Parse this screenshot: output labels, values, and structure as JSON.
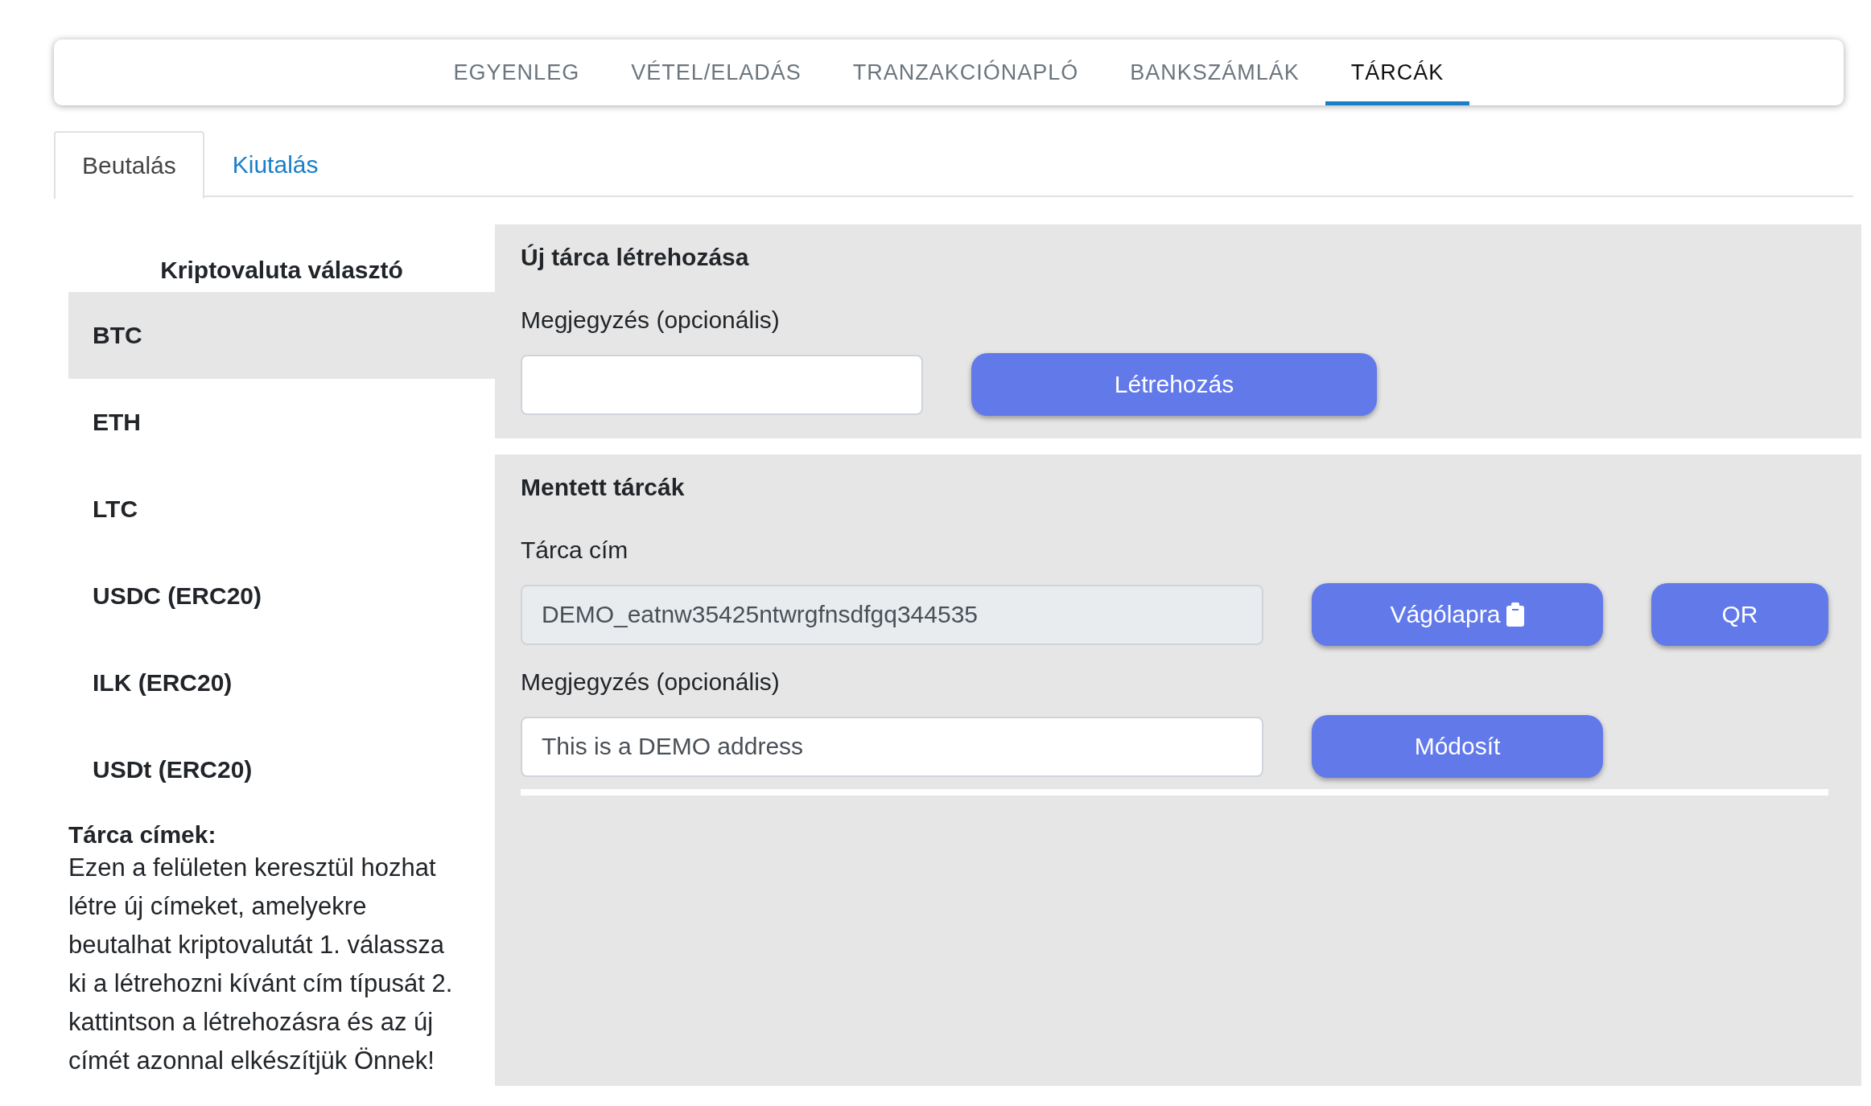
{
  "nav": {
    "items": [
      {
        "label": "EGYENLEG",
        "selected": false
      },
      {
        "label": "VÉTEL/ELADÁS",
        "selected": false
      },
      {
        "label": "TRANZAKCIÓNAPLÓ",
        "selected": false
      },
      {
        "label": "BANKSZÁMLÁK",
        "selected": false
      },
      {
        "label": "TÁRCÁK",
        "selected": true
      }
    ]
  },
  "tabs": [
    {
      "label": "Beutalás",
      "selected": true
    },
    {
      "label": "Kiutalás",
      "selected": false
    }
  ],
  "sidebar": {
    "title": "Kriptovaluta választó",
    "items": [
      {
        "label": "BTC",
        "selected": true
      },
      {
        "label": "ETH",
        "selected": false
      },
      {
        "label": "LTC",
        "selected": false
      },
      {
        "label": "USDC (ERC20)",
        "selected": false
      },
      {
        "label": "ILK (ERC20)",
        "selected": false
      },
      {
        "label": "USDt (ERC20)",
        "selected": false
      }
    ]
  },
  "info": {
    "title": "Tárca címek:",
    "text": "Ezen a felületen keresztül hozhat létre új címeket, amelyekre beutalhat kriptovalutát 1. válassza ki a létrehozni kívánt cím típusát 2. kattintson a létrehozásra és az új címét azonnal elkészítjük Önnek!"
  },
  "new_wallet": {
    "title": "Új tárca létrehozása",
    "note_label": "Megjegyzés (opcionális)",
    "create_button": "Létrehozás"
  },
  "saved_wallets": {
    "title": "Mentett tárcák",
    "address_label": "Tárca cím",
    "address": {
      "value": "DEMO_eatnw35425ntwrgfnsdfgq344535",
      "readonly": true
    },
    "copy_button": "Vágólapra",
    "qr_button": "QR",
    "note_label": "Megjegyzés (opcionális)",
    "note": {
      "value": "This is a DEMO address"
    },
    "modify_button": "Módosít"
  }
}
